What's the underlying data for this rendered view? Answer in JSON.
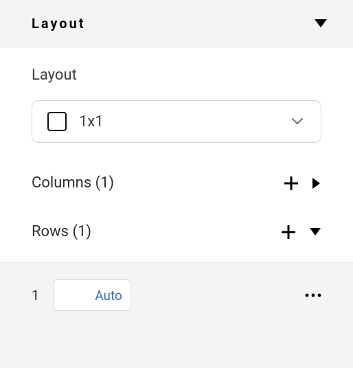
{
  "header": {
    "title": "Layout"
  },
  "section": {
    "label": "Layout",
    "select_value": "1x1"
  },
  "columns": {
    "label": "Columns (1)"
  },
  "rows": {
    "label": "Rows (1)"
  },
  "row_item": {
    "index": "1",
    "value": "",
    "auto_label": "Auto"
  }
}
